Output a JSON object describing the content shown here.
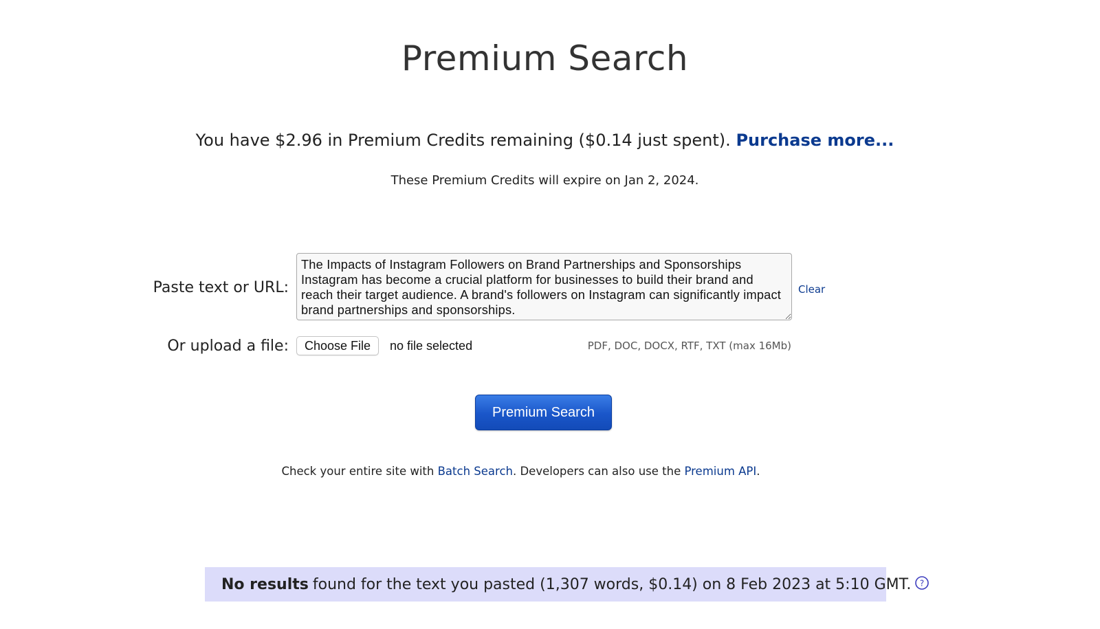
{
  "header": {
    "title": "Premium Search"
  },
  "credits": {
    "text": "You have $2.96 in Premium Credits remaining ($0.14 just spent).",
    "purchase_label": "Purchase more...",
    "expiry_text": "These Premium Credits will expire on Jan 2, 2024."
  },
  "form": {
    "paste_label": "Paste text or URL:",
    "paste_value": "The Impacts of Instagram Followers on Brand Partnerships and Sponsorships\nInstagram has become a crucial platform for businesses to build their brand and reach their target audience. A brand's followers on Instagram can significantly impact brand partnerships and sponsorships.",
    "clear_label": "Clear",
    "upload_label": "Or upload a file:",
    "choose_file_label": "Choose File",
    "file_status": "no file selected",
    "file_types": "PDF, DOC, DOCX, RTF, TXT (max 16Mb)",
    "submit_label": "Premium Search"
  },
  "footer": {
    "prefix": "Check your entire site with ",
    "batch_link": "Batch Search",
    "middle": ". Developers can also use the ",
    "api_link": "Premium API",
    "suffix": "."
  },
  "results": {
    "bold_text": "No results",
    "detail_text": "found for the text you pasted (1,307 words, $0.14) on 8 Feb 2023 at 5:10 GMT.",
    "help_icon": "question-circle-icon"
  },
  "colors": {
    "link": "#0b3a8f",
    "button": "#1a56c9",
    "results_background": "#dcdcfa"
  }
}
